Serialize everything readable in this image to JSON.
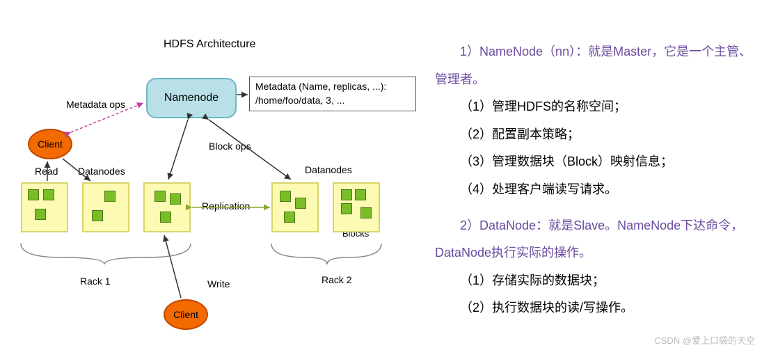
{
  "diagram": {
    "title": "HDFS Architecture",
    "namenode": "Namenode",
    "metadata_line1": "Metadata (Name, replicas, ...):",
    "metadata_line2": "/home/foo/data, 3, ...",
    "client": "Client",
    "meta_ops": "Metadata ops",
    "block_ops": "Block ops",
    "read": "Read",
    "write": "Write",
    "datanodes": "Datanodes",
    "replication": "Replication",
    "rack1": "Rack 1",
    "rack2": "Rack 2",
    "blocks": "Blocks"
  },
  "text": {
    "h1": "1）NameNode（nn）：就是Master，它是一个主管、管理者。",
    "p11": "（1）管理HDFS的名称空间；",
    "p12": "（2）配置副本策略；",
    "p13": "（3）管理数据块（Block）映射信息；",
    "p14": "（4）处理客户端读写请求。",
    "h2": "2）DataNode：就是Slave。NameNode下达命令，DataNode执行实际的操作。",
    "p21": "（1）存储实际的数据块；",
    "p22": "（2）执行数据块的读/写操作。"
  },
  "watermark": "CSDN @爱上口袋的天空"
}
